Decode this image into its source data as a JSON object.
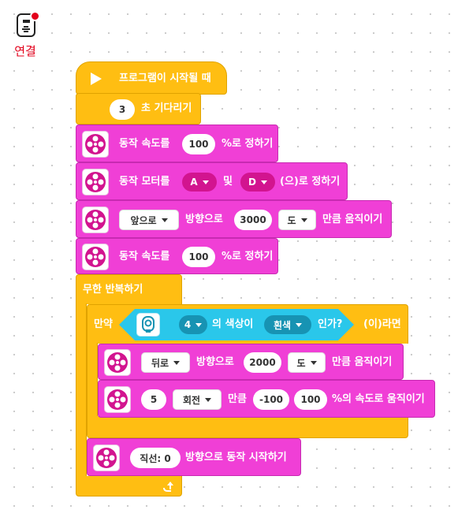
{
  "connection": {
    "label": "연결",
    "status_color": "#e3001b"
  },
  "colors": {
    "events": "#ffbe12",
    "motors": "#f03fd6",
    "sensors": "#2ac7ea",
    "port": "#d2148f"
  },
  "blocks": {
    "start": {
      "label": "프로그램이 시작될 때"
    },
    "wait": {
      "value": "3",
      "label": "초 기다리기"
    },
    "set_speed_1": {
      "prefix": "동작 속도를",
      "value": "100",
      "suffix": "%로 정하기"
    },
    "set_motors": {
      "prefix": "동작 모터를",
      "port_a": "A",
      "and": "및",
      "port_b": "D",
      "suffix": "(으)로 정하기"
    },
    "move_1": {
      "direction": "앞으로",
      "dir_suffix": "방향으로",
      "amount": "3000",
      "unit": "도",
      "suffix": "만큼 움직이기"
    },
    "set_speed_2": {
      "prefix": "동작 속도를",
      "value": "100",
      "suffix": "%로 정하기"
    },
    "forever": {
      "label": "무한 반복하기"
    },
    "if": {
      "label": "만약",
      "sensor_port": "4",
      "sensor_mid": "의 색상이",
      "color": "흰색",
      "question": "인가?",
      "then": "(이)라면"
    },
    "move_2": {
      "direction": "뒤로",
      "dir_suffix": "방향으로",
      "amount": "2000",
      "unit": "도",
      "suffix": "만큼 움직이기"
    },
    "move_3": {
      "amount": "5",
      "unit": "회전",
      "mid": "만큼",
      "left_speed": "-100",
      "right_speed": "100",
      "suffix": "%의 속도로 움직이기"
    },
    "start_move": {
      "steering": "직선: 0",
      "suffix": "방향으로 동작 시작하기"
    }
  }
}
